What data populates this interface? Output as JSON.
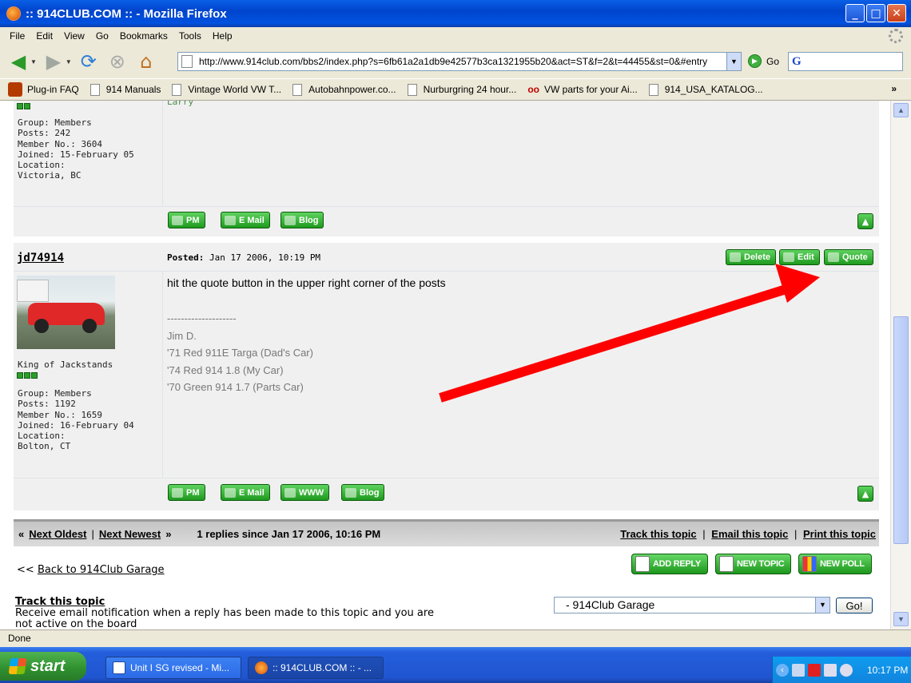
{
  "window": {
    "title": ":: 914CLUB.COM :: - Mozilla Firefox",
    "min": "_",
    "max": "□",
    "close": "✕"
  },
  "menu": [
    "File",
    "Edit",
    "View",
    "Go",
    "Bookmarks",
    "Tools",
    "Help"
  ],
  "nav": {
    "url": "http://www.914club.com/bbs2/index.php?s=6fb61a2a1db9e42577b3ca1321955b20&act=ST&f=2&t=44455&st=0&#entry",
    "go_label": "Go",
    "search_glyph": "G"
  },
  "bookmarks": [
    "Plug-in FAQ",
    "914 Manuals",
    "Vintage World VW T...",
    "Autobahnpower.co...",
    "Nurburgring 24 hour...",
    "VW parts for your Ai...",
    "914_USA_KATALOG..."
  ],
  "bookmarks_more": "»",
  "post_prev": {
    "sig_tail": "Larry",
    "group": "Group: Members",
    "posts": "Posts: 242",
    "member_no": "Member No.: 3604",
    "joined": "Joined: 15-February 05",
    "location": "Location:",
    "location_value": "Victoria, BC",
    "buttons": [
      "PM",
      "E Mail",
      "Blog"
    ],
    "up": "▲"
  },
  "post": {
    "author": "jd74914",
    "posted_label": "Posted:",
    "posted_date": "Jan 17 2006, 10:19 PM",
    "actions": [
      "Delete",
      "Edit",
      "Quote"
    ],
    "rank": "King of Jackstands",
    "group": "Group: Members",
    "posts": "Posts: 1192",
    "member_no": "Member No.: 1659",
    "joined": "Joined: 16-February 04",
    "location": "Location:",
    "location_value": "Bolton, CT",
    "body": "hit the quote button in the upper right corner of the posts",
    "signature": [
      "--------------------",
      "Jim D.",
      "'71 Red 911E Targa (Dad's Car)",
      "'74 Red 914 1.8 (My Car)",
      "'70 Green 914 1.7 (Parts Car)"
    ],
    "buttons": [
      "PM",
      "E Mail",
      "WWW",
      "Blog"
    ],
    "up": "▲"
  },
  "topic_nav": {
    "prev_mark": "«",
    "next_oldest": "Next Oldest",
    "sep": "|",
    "next_newest": "Next Newest",
    "next_mark": "»",
    "replies": "1 replies since Jan 17 2006, 10:16 PM",
    "track": "Track this topic",
    "email": "Email this topic",
    "print": "Print this topic"
  },
  "actions": {
    "add_reply": "ADD REPLY",
    "new_topic": "NEW TOPIC",
    "new_poll": "NEW POLL"
  },
  "back": {
    "prefix": "<<",
    "label": "Back to 914Club Garage"
  },
  "track_section": {
    "title": "Track this topic",
    "desc_line1": "Receive email notification when a reply has been made to this topic and you are",
    "desc_line2": "not active on the board"
  },
  "forum_select": {
    "value": "- 914Club Garage",
    "go": "Go!"
  },
  "status": "Done",
  "taskbar": {
    "start": "start",
    "tasks": [
      "Unit I SG revised - Mi...",
      ":: 914CLUB.COM :: - ..."
    ],
    "clock": "10:17 PM",
    "tray_chevron": "‹"
  },
  "colors": {
    "annotation_arrow": "#ff0000",
    "button_green": "#1e9a1e",
    "title_blue": "#0052e0"
  }
}
